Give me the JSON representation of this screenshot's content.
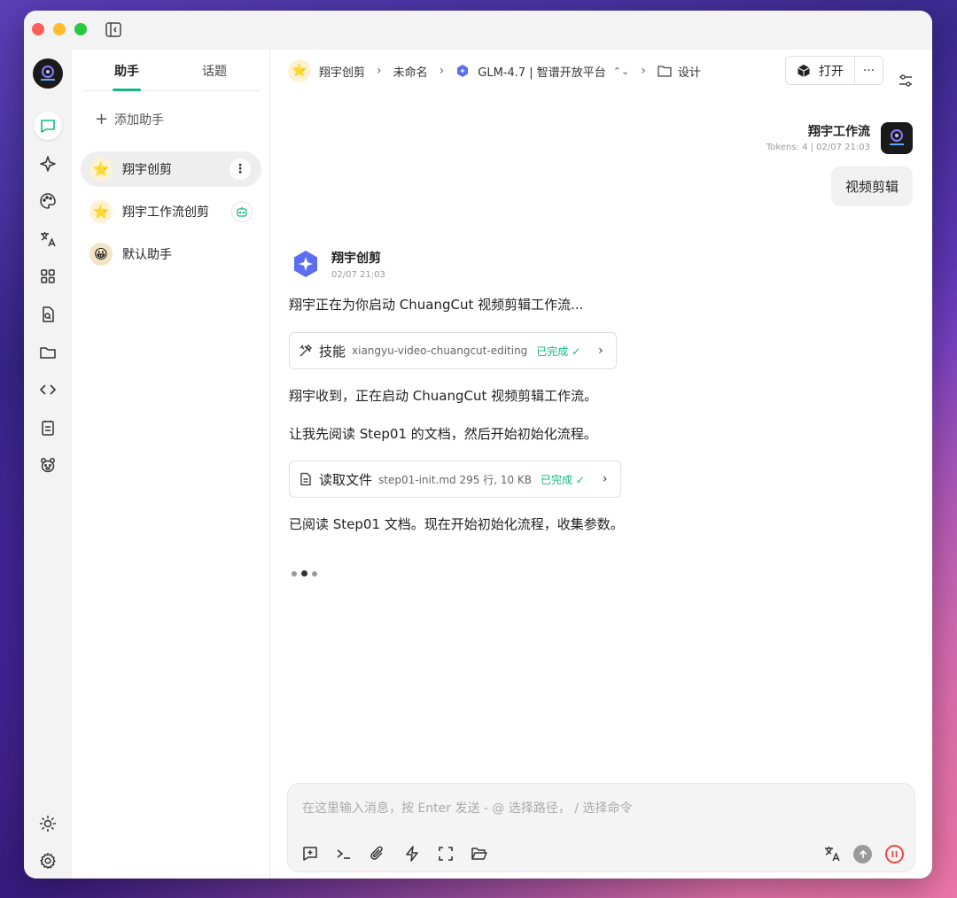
{
  "tabs": {
    "assistant": "助手",
    "topic": "话题"
  },
  "panel": {
    "add_label": "添加助手",
    "assistants": [
      {
        "name": "翔宇创剪",
        "icon": "star-emoji-icon"
      },
      {
        "name": "翔宇工作流创剪",
        "icon": "star-emoji-icon"
      },
      {
        "name": "默认助手",
        "icon": "smile-emoji-icon"
      }
    ]
  },
  "breadcrumb": {
    "assistant": "翔宇创剪",
    "topic": "未命名",
    "model": "GLM-4.7 | 智谱开放平台",
    "folder": "设计"
  },
  "toolbar": {
    "open_label": "打开",
    "more_label": "···"
  },
  "user_message": {
    "name": "翔宇工作流",
    "meta": "Tokens: 4 | 02/07 21:03",
    "text": "视频剪辑"
  },
  "bot_message": {
    "name": "翔宇创剪",
    "time": "02/07 21:03",
    "line1": "翔宇正在为你启动 ChuangCut 视频剪辑工作流...",
    "tool1": {
      "title": "技能",
      "detail": "xiangyu-video-chuangcut-editing",
      "status": "已完成 ✓"
    },
    "line2": "翔宇收到，正在启动 ChuangCut 视频剪辑工作流。",
    "line3": "让我先阅读 Step01 的文档，然后开始初始化流程。",
    "tool2": {
      "title": "读取文件",
      "detail": "step01-init.md 295 行, 10 KB",
      "status": "已完成 ✓"
    },
    "line4": "已阅读 Step01 文档。现在开始初始化流程，收集参数。"
  },
  "composer": {
    "placeholder": "在这里输入消息，按 Enter 发送 - @ 选择路径， / 选择命令",
    "value": ""
  },
  "colors": {
    "accent": "#10b981",
    "danger": "#ef4444"
  }
}
